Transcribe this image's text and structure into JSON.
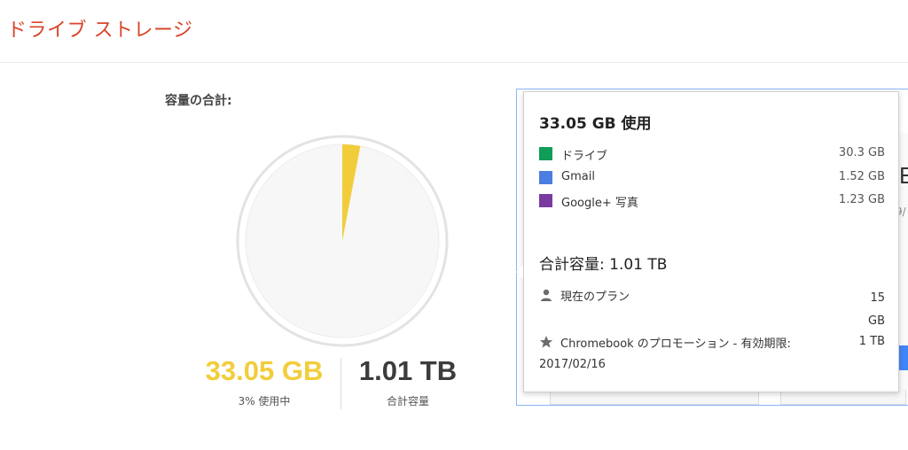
{
  "page": {
    "title": "ドライブ ストレージ",
    "capacity_label": "容量の合計:"
  },
  "summary": {
    "used_value": "33.05 GB",
    "used_caption": "3% 使用中",
    "total_value": "1.01 TB",
    "total_caption": "合計容量",
    "used_fraction": 0.03,
    "colors": {
      "used": "#f2cd3b",
      "pie_bg": "#f7f7f7",
      "ring": "#e6e6e6"
    }
  },
  "popup": {
    "used_title": "33.05 GB 使用",
    "items": [
      {
        "label": "ドライブ",
        "value": "30.3 GB",
        "color": "#0f9d58"
      },
      {
        "label": "Gmail",
        "value": "1.52 GB",
        "color": "#4a7ee0"
      },
      {
        "label": "Google+ 写真",
        "value": "1.23 GB",
        "color": "#7b3aa0"
      }
    ],
    "total_title": "合計容量: 1.01 TB",
    "plans": [
      {
        "icon": "person-icon",
        "label": "現在のプラン",
        "value_line1": "15",
        "value_line2": "GB"
      },
      {
        "icon": "star-icon",
        "label": "Chromebook のプロモーション - 有効期限:",
        "value_line1": "1 TB",
        "date": "2017/02/16"
      }
    ]
  }
}
